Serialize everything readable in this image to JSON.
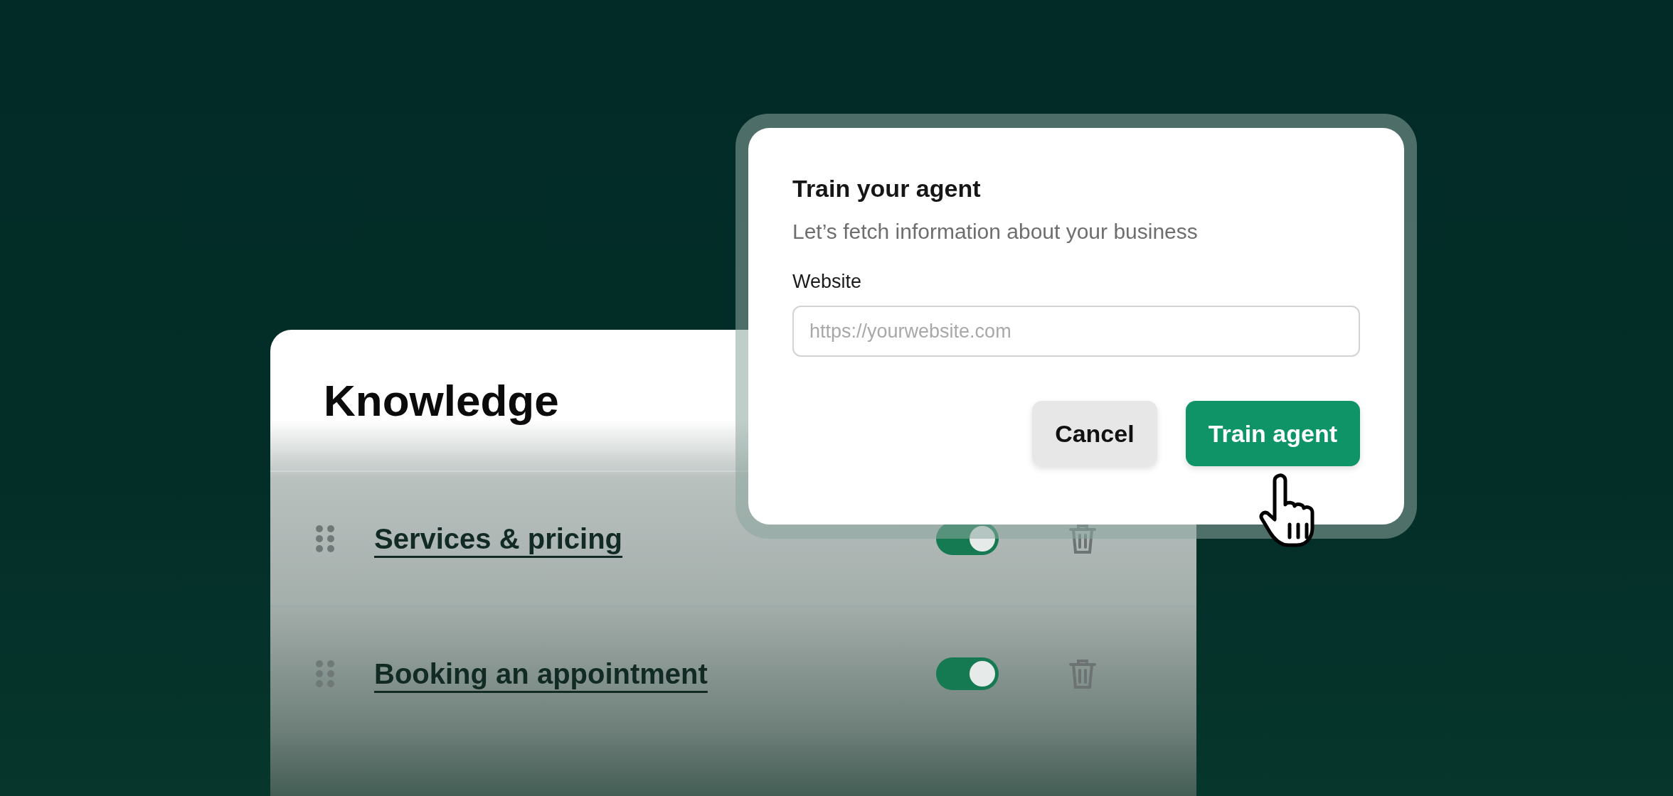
{
  "knowledge": {
    "title": "Knowledge",
    "items": [
      {
        "label": "Services & pricing",
        "on": true
      },
      {
        "label": "Booking an appointment",
        "on": true
      }
    ]
  },
  "dialog": {
    "title": "Train your agent",
    "subtitle": "Let’s fetch information about your business",
    "field_label": "Website",
    "placeholder": "https://yourwebsite.com",
    "buttons": [
      {
        "label": "Cancel",
        "kind": "secondary"
      },
      {
        "label": "Train agent",
        "kind": "primary"
      }
    ]
  }
}
